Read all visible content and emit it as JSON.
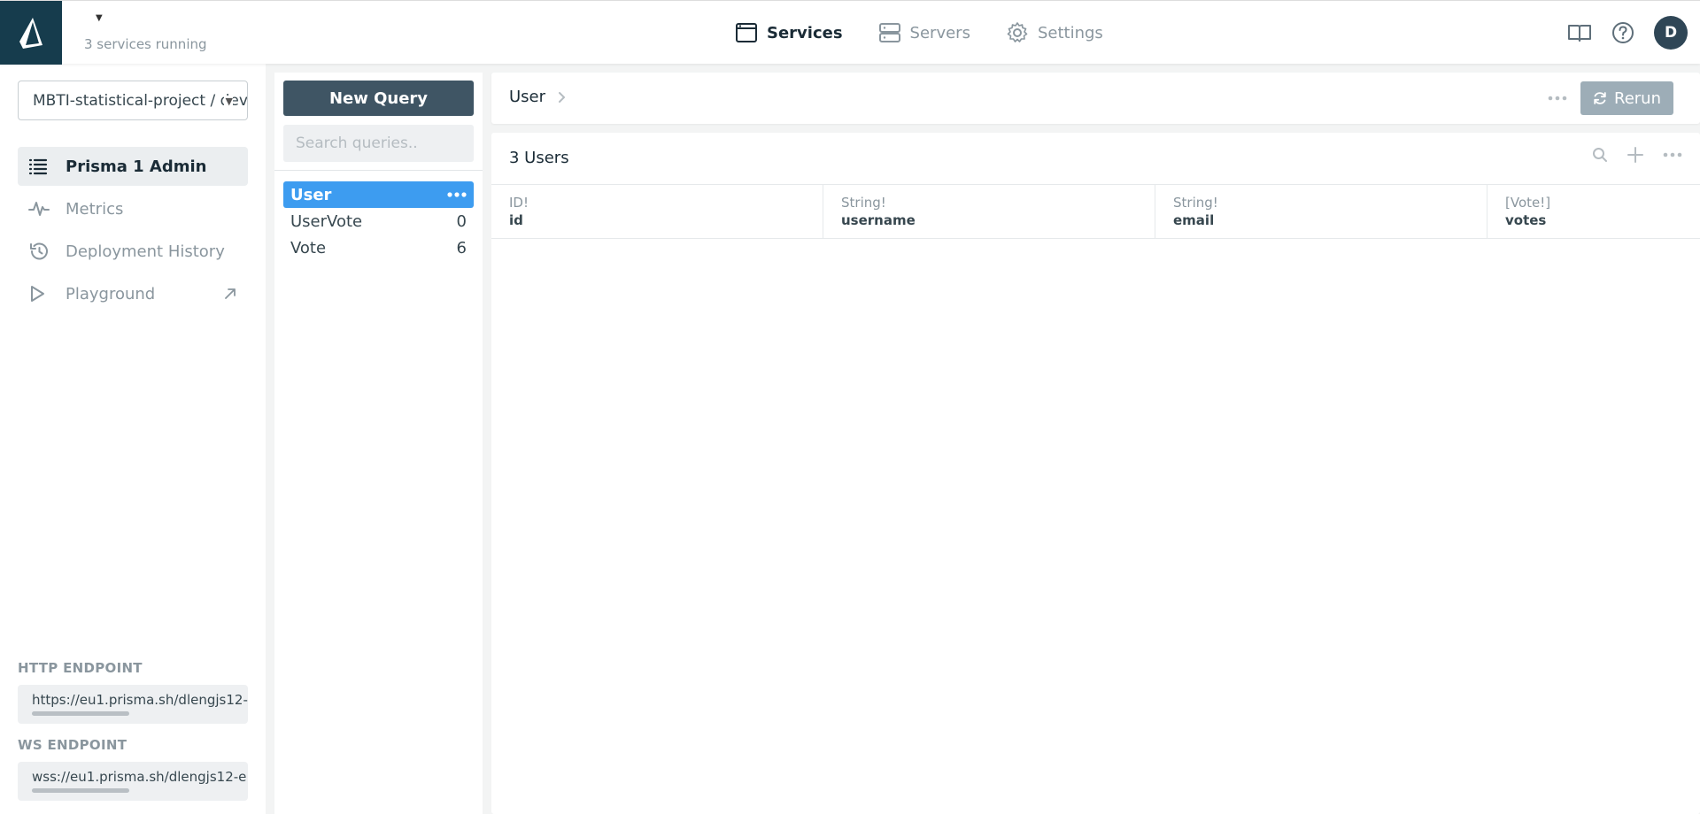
{
  "header": {
    "services_running": "3 services running",
    "nav": [
      {
        "label": "Services",
        "icon": "window-icon",
        "active": true
      },
      {
        "label": "Servers",
        "icon": "servers-icon",
        "active": false
      },
      {
        "label": "Settings",
        "icon": "gear-icon",
        "active": false
      }
    ],
    "avatar_initial": "D"
  },
  "sidebar": {
    "project": "MBTI-statistical-project / dev",
    "items": [
      {
        "label": "Prisma 1 Admin",
        "icon": "list-icon",
        "active": true
      },
      {
        "label": "Metrics",
        "icon": "pulse-icon",
        "active": false
      },
      {
        "label": "Deployment History",
        "icon": "history-icon",
        "active": false
      },
      {
        "label": "Playground",
        "icon": "play-icon",
        "active": false
      }
    ],
    "http_label": "HTTP ENDPOINT",
    "http_value": "https://eu1.prisma.sh/dlengjs12-",
    "ws_label": "WS ENDPOINT",
    "ws_value": "wss://eu1.prisma.sh/dlengjs12-e"
  },
  "queries": {
    "new_query": "New Query",
    "search_placeholder": "Search queries..",
    "items": [
      {
        "name": "User",
        "count": "",
        "active": true
      },
      {
        "name": "UserVote",
        "count": "0",
        "active": false
      },
      {
        "name": "Vote",
        "count": "6",
        "active": false
      }
    ]
  },
  "main": {
    "breadcrumb": "User",
    "rerun": "Rerun",
    "count_label": "3 Users",
    "columns": [
      {
        "type": "ID!",
        "name": "id"
      },
      {
        "type": "String!",
        "name": "username"
      },
      {
        "type": "String!",
        "name": "email"
      },
      {
        "type": "[Vote!]",
        "name": "votes"
      }
    ]
  },
  "colors": {
    "logo_bg": "#163c4d",
    "accent_blue": "#3d9cf0",
    "button_dark": "#3f5564",
    "rerun_bg": "#9dadb7"
  }
}
